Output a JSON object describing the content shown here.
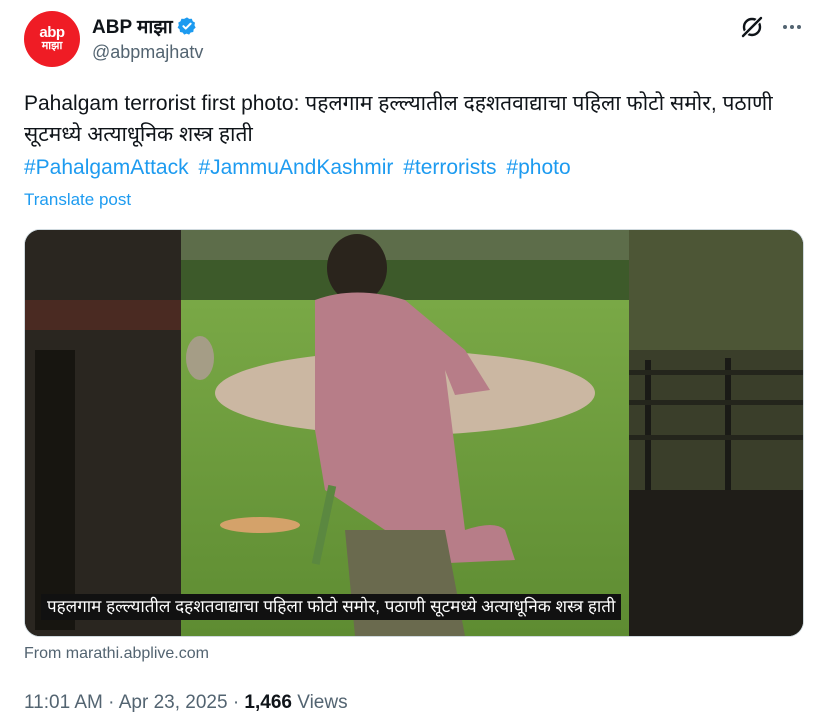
{
  "author": {
    "avatar_line1": "abp",
    "avatar_line2": "माझा",
    "display_name": "ABP माझा",
    "handle": "@abpmajhatv"
  },
  "post": {
    "text": "Pahalgam terrorist first photo: पहलगाम हल्ल्यातील दहशतवाद्याचा पहिला फोटो समोर, पठाणी सूटमध्ये अत्याधूनिक शस्त्र हाती",
    "hashtags": [
      "#PahalgamAttack",
      "#JammuAndKashmir",
      "#terrorists",
      "#photo"
    ],
    "translate_label": "Translate post",
    "media_caption": "पहलगाम हल्ल्यातील दहशतवाद्याचा पहिला फोटो समोर, पठाणी सूटमध्ये अत्याधूनिक शस्त्र हाती",
    "source": "From marathi.abplive.com",
    "time": "11:01 AM",
    "date": "Apr 23, 2025",
    "views_count": "1,466",
    "views_label": "Views"
  },
  "icons": {
    "grok": "grok-icon",
    "more": "more-dots-icon",
    "verified": "verified-badge-icon"
  },
  "colors": {
    "accent": "#1d9bf0",
    "brand": "#ef1c25",
    "secondary_text": "#536471"
  }
}
